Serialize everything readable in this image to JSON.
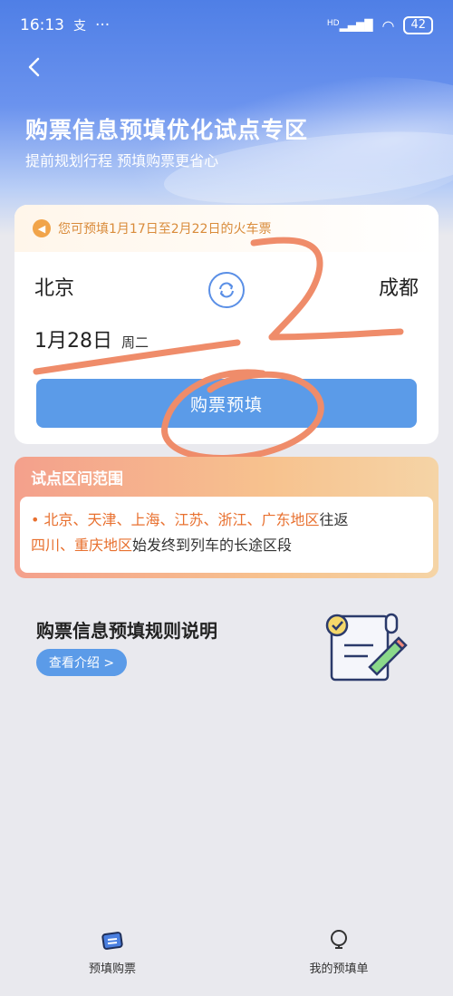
{
  "status_bar": {
    "time": "16:13",
    "app_badge": "支",
    "dots": "···",
    "hd": "HD",
    "battery": "42"
  },
  "header": {
    "title": "购票信息预填优化试点专区",
    "subtitle": "提前规划行程 预填购票更省心"
  },
  "notice": {
    "text": "您可预填1月17日至2月22日的火车票"
  },
  "trip": {
    "from": "北京",
    "to": "成都",
    "date": "1月28日",
    "weekday": "周二"
  },
  "book_button": "购票预填",
  "pilot": {
    "title": "试点区间范围",
    "regions_line1": "北京、天津、上海、江苏、浙江、广东地区",
    "suffix1": "往返",
    "regions_line2": "四川、重庆地区",
    "suffix2": "始发终到列车的长途区段"
  },
  "rules": {
    "title": "购票信息预填规则说明",
    "button": "查看介绍 >"
  },
  "nav": {
    "left": "预填购票",
    "right": "我的预填单"
  },
  "colors": {
    "accent": "#5b9be8",
    "banner": "#4f7fe6",
    "notice_text": "#d98b3a",
    "region": "#e8702f",
    "scribble": "#ef8c6a"
  }
}
